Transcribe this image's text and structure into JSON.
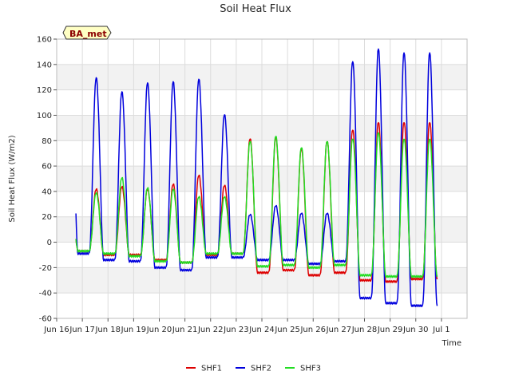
{
  "chart_data": {
    "type": "line",
    "title": "Soil Heat Flux",
    "xlabel": "Time",
    "ylabel": "Soil Heat Flux (W/m2)",
    "site_badge": "BA_met",
    "ylim": [
      -60,
      160
    ],
    "yticks": [
      -60,
      -40,
      -20,
      0,
      20,
      40,
      60,
      80,
      100,
      120,
      140,
      160
    ],
    "xlim": [
      15.0,
      31.0
    ],
    "xticks": [
      {
        "pos": 15,
        "label": "Jun 16"
      },
      {
        "pos": 16,
        "label": "Jun 17"
      },
      {
        "pos": 17,
        "label": "Jun 18"
      },
      {
        "pos": 18,
        "label": "Jun 19"
      },
      {
        "pos": 19,
        "label": "Jun 20"
      },
      {
        "pos": 20,
        "label": "Jun 21"
      },
      {
        "pos": 21,
        "label": "Jun 22"
      },
      {
        "pos": 22,
        "label": "Jun 23"
      },
      {
        "pos": 23,
        "label": "Jun 24"
      },
      {
        "pos": 24,
        "label": "Jun 25"
      },
      {
        "pos": 25,
        "label": "Jun 26"
      },
      {
        "pos": 26,
        "label": "Jun 27"
      },
      {
        "pos": 27,
        "label": "Jun 28"
      },
      {
        "pos": 28,
        "label": "Jun 29"
      },
      {
        "pos": 29,
        "label": "Jun 30"
      },
      {
        "pos": 30,
        "label": "Jul 1"
      }
    ],
    "grid": true,
    "legend_position": "bottom-center",
    "series": [
      {
        "name": "SHF1",
        "color": "#dd0000",
        "night_min": [
          -6,
          -7,
          -10,
          -10,
          -14,
          -16,
          -10,
          -9,
          -24,
          -22,
          -26,
          -24,
          -30,
          -31,
          -29
        ],
        "day_peak": [
          40,
          42,
          44,
          42,
          46,
          53,
          45,
          82,
          83,
          74,
          80,
          89,
          95,
          95
        ]
      },
      {
        "name": "SHF2",
        "color": "#0000dd",
        "night_min": [
          -9,
          -9,
          -14,
          -15,
          -20,
          -22,
          -12,
          -12,
          -14,
          -14,
          -17,
          -15,
          -44,
          -48,
          -50
        ],
        "day_peak": [
          141,
          130,
          119,
          126,
          127,
          129,
          101,
          22,
          29,
          23,
          23,
          143,
          153,
          150
        ]
      },
      {
        "name": "SHF3",
        "color": "#22dd22",
        "night_min": [
          -7,
          -7,
          -9,
          -11,
          -15,
          -16,
          -9,
          -9,
          -19,
          -18,
          -20,
          -18,
          -26,
          -27,
          -27
        ],
        "day_peak": [
          40,
          39,
          51,
          43,
          42,
          36,
          36,
          80,
          84,
          75,
          80,
          82,
          87,
          82
        ]
      }
    ]
  }
}
